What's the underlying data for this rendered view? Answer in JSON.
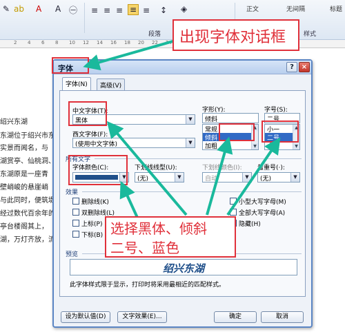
{
  "ribbon": {
    "section_paragraph": "段落",
    "section_style": "样式",
    "style_normal": "正文",
    "style_nospacing": "无间隔",
    "style_heading": "标题"
  },
  "ruler_ticks": [
    "2",
    "4",
    "6",
    "8",
    "10",
    "12",
    "14",
    "16",
    "18",
    "20",
    "22",
    "24",
    "26",
    "28",
    "30",
    "32",
    "34",
    "36",
    "38",
    "40"
  ],
  "document": {
    "lines": [
      "绍兴东湖",
      "东湖位于绍兴市东",
      "实景而闻名，与",
      "湖赏亭、仙桃洞、",
      "东湖原是一座青",
      "壁峭峻的悬崖峭",
      "与此同时，便筑堤为界,",
      "经过数代百余年的",
      "亭台楼阁其上，",
      "湖，万灯齐放，流"
    ]
  },
  "dialog": {
    "title": "字体",
    "help_glyph": "?",
    "close_glyph": "×",
    "tabs": [
      {
        "label": "字体(N)",
        "active": true
      },
      {
        "label": "高级(V)",
        "active": false
      }
    ],
    "chinese_font": {
      "label": "中文字体(T):",
      "value": "黑体"
    },
    "western_font": {
      "label": "西文字体(F):",
      "value": "(使用中文字体)"
    },
    "font_style": {
      "label": "字形(Y):",
      "value": "倾斜",
      "options": [
        "常规",
        "倾斜",
        "加粗"
      ],
      "selected": "倾斜"
    },
    "font_size": {
      "label": "字号(S):",
      "value": "二号",
      "options": [
        "小一",
        "二号",
        "小二"
      ],
      "selected": "二号"
    },
    "all_text_section": "所有文字",
    "font_color": {
      "label": "字体颜色(C):",
      "color": "#1f4f8a"
    },
    "underline_type": {
      "label": "下划线线型(U):",
      "value": "(无)"
    },
    "underline_color": {
      "label": "下划线颜色(I):",
      "value": "自动"
    },
    "emphasis": {
      "label": "着重号(·):",
      "value": "(无)"
    },
    "effects_section": "效果",
    "effects_left": [
      "删除线(K)",
      "双删除线(L)",
      "上标(P)",
      "下标(B)"
    ],
    "effects_right": [
      "小型大写字母(M)",
      "全部大写字母(A)",
      "隐藏(H)"
    ],
    "preview_section": "预览",
    "preview_text": "绍兴东湖",
    "preview_note": "此字体样式限于显示，打印时将采用最相近的匹配样式。",
    "buttons": {
      "set_default": "设为默认值(D)",
      "text_effects": "文字效果(E)...",
      "ok": "确定",
      "cancel": "取消"
    }
  },
  "annotations": {
    "callout_top": "出现字体对话框",
    "callout_bottom_line1": "选择黑体、倾斜",
    "callout_bottom_line2": "二号、蓝色",
    "arrow_color": "#1ab99c",
    "red_color": "#e0303a"
  }
}
